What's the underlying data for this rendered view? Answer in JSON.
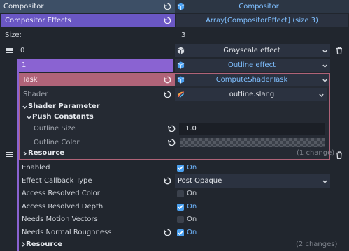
{
  "compositor": {
    "label": "Compositor",
    "value": "Compositor"
  },
  "effects": {
    "label": "Compositor Effects",
    "value": "Array[CompositorEffect] (size 3)"
  },
  "size": {
    "label": "Size:",
    "value": "3"
  },
  "item0": {
    "index": "0",
    "value": "Grayscale effect"
  },
  "item1": {
    "index": "1",
    "value": "Outline effect"
  },
  "task": {
    "label": "Task",
    "value": "ComputeShaderTask"
  },
  "shader": {
    "label": "Shader",
    "value": "outline.slang"
  },
  "shader_parameter": {
    "label": "Shader Parameter"
  },
  "push_constants": {
    "label": "Push Constants"
  },
  "outline_size": {
    "label": "Outline Size",
    "value": "1.0"
  },
  "outline_color": {
    "label": "Outline Color"
  },
  "resource_inner": {
    "label": "Resource",
    "changes": "(1 change)"
  },
  "enabled": {
    "label": "Enabled",
    "value": "On"
  },
  "callback_type": {
    "label": "Effect Callback Type",
    "value": "Post Opaque"
  },
  "access_color": {
    "label": "Access Resolved Color",
    "value": "On"
  },
  "access_depth": {
    "label": "Access Resolved Depth",
    "value": "On"
  },
  "motion_vectors": {
    "label": "Needs Motion Vectors",
    "value": "On"
  },
  "normal_roughness": {
    "label": "Needs Normal Roughness",
    "value": "On"
  },
  "resource_outer": {
    "label": "Resource",
    "changes": "(2 changes)"
  },
  "colors": {
    "accent_blue": "#4aa0f0",
    "compositor_header": "#3d4f66",
    "effects_purple": "#6a57c4",
    "item_purple": "#8a63d2",
    "task_pink": "#b06378",
    "on_text": "#6fb6ff"
  }
}
